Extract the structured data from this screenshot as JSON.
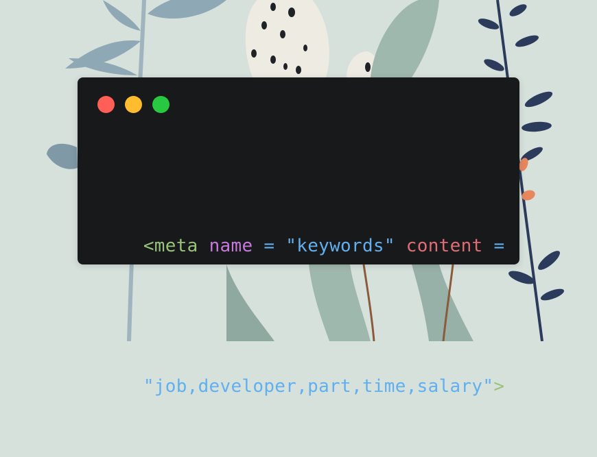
{
  "colors": {
    "background": "#d7e1dc",
    "window": "#18191b",
    "close_dot": "#ff5f57",
    "minimize_dot": "#febc2e",
    "zoom_dot": "#28c840",
    "token_tag": "#98c379",
    "token_attr_name": "#c678dd",
    "token_attr_content": "#e06c75",
    "token_string": "#61afef",
    "token_operator": "#61afef"
  },
  "icons": {
    "close": "close-dot-icon",
    "minimize": "minimize-dot-icon",
    "zoom": "zoom-dot-icon"
  },
  "code": {
    "line1": [
      {
        "text": "<meta",
        "token": "tag"
      },
      {
        "text": " ",
        "token": "space"
      },
      {
        "text": "name",
        "token": "attr_name"
      },
      {
        "text": " = ",
        "token": "operator"
      },
      {
        "text": "\"keywords\"",
        "token": "string"
      },
      {
        "text": " ",
        "token": "space"
      },
      {
        "text": "content",
        "token": "attr_content"
      },
      {
        "text": " =",
        "token": "operator"
      }
    ],
    "line2": [
      {
        "text": "\"job,developer,part,time,salary\"",
        "token": "string"
      },
      {
        "text": ">",
        "token": "tag"
      }
    ]
  }
}
